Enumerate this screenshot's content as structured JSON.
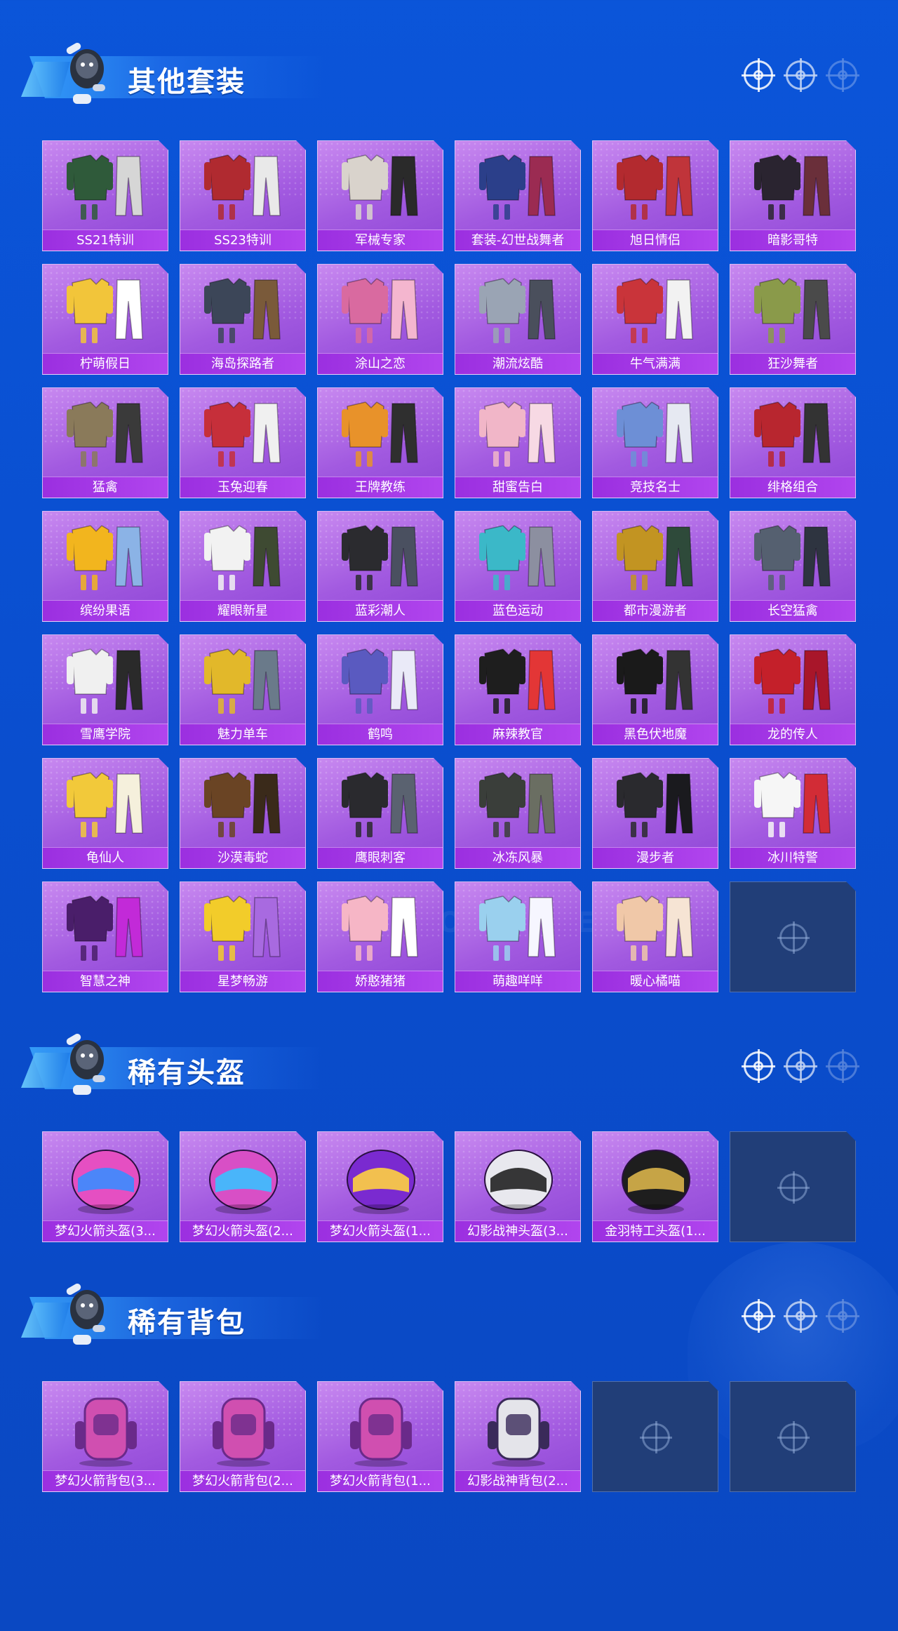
{
  "watermark": "GAME FOR PEACE",
  "sections": [
    {
      "title": "其他套装",
      "items": [
        {
          "label": "SS21特训",
          "icon": "outfit-green-icon"
        },
        {
          "label": "SS23特训",
          "icon": "outfit-red-jacket-icon"
        },
        {
          "label": "军械专家",
          "icon": "outfit-sweater-icon"
        },
        {
          "label": "套装-幻世战舞者",
          "icon": "outfit-blue-armor-icon"
        },
        {
          "label": "旭日情侣",
          "icon": "outfit-red-hoodie-icon"
        },
        {
          "label": "暗影哥特",
          "icon": "outfit-gothic-icon"
        },
        {
          "label": "柠萌假日",
          "icon": "outfit-yellow-dress-icon"
        },
        {
          "label": "海岛探路者",
          "icon": "outfit-explorer-icon"
        },
        {
          "label": "涂山之恋",
          "icon": "outfit-pink-robe-icon"
        },
        {
          "label": "潮流炫酷",
          "icon": "outfit-silver-jacket-icon"
        },
        {
          "label": "牛气满满",
          "icon": "outfit-red-festive-icon"
        },
        {
          "label": "狂沙舞者",
          "icon": "outfit-desert-scarf-icon"
        },
        {
          "label": "猛禽",
          "icon": "outfit-khaki-icon"
        },
        {
          "label": "玉兔迎春",
          "icon": "outfit-red-white-icon"
        },
        {
          "label": "王牌教练",
          "icon": "outfit-orange-vest-icon"
        },
        {
          "label": "甜蜜告白",
          "icon": "outfit-pink-icon"
        },
        {
          "label": "竞技名士",
          "icon": "outfit-blue-white-icon"
        },
        {
          "label": "绯格组合",
          "icon": "outfit-red-plaid-icon"
        },
        {
          "label": "缤纷果语",
          "icon": "outfit-fruit-icon"
        },
        {
          "label": "耀眼新星",
          "icon": "outfit-white-shirt-icon"
        },
        {
          "label": "蓝彩潮人",
          "icon": "outfit-black-jacket-icon"
        },
        {
          "label": "蓝色运动",
          "icon": "outfit-teal-sport-icon"
        },
        {
          "label": "都市漫游者",
          "icon": "outfit-yellow-hood-icon"
        },
        {
          "label": "长空猛禽",
          "icon": "outfit-camo-icon"
        },
        {
          "label": "雪鹰学院",
          "icon": "outfit-school-icon"
        },
        {
          "label": "魅力单车",
          "icon": "outfit-yellow-tee-icon"
        },
        {
          "label": "鹤鸣",
          "icon": "outfit-crane-hoodie-icon"
        },
        {
          "label": "麻辣教官",
          "icon": "outfit-striped-icon"
        },
        {
          "label": "黑色伏地魔",
          "icon": "outfit-black-hoodie-icon"
        },
        {
          "label": "龙的传人",
          "icon": "outfit-qipao-icon"
        },
        {
          "label": "龟仙人",
          "icon": "outfit-hawaiian-icon"
        },
        {
          "label": "沙漠毒蛇",
          "icon": "outfit-leather-icon"
        },
        {
          "label": "鹰眼刺客",
          "icon": "outfit-assassin-icon"
        },
        {
          "label": "冰冻风暴",
          "icon": "outfit-tactical-icon"
        },
        {
          "label": "漫步者",
          "icon": "outfit-walker-icon"
        },
        {
          "label": "冰川特警",
          "icon": "outfit-white-red-icon"
        },
        {
          "label": "智慧之神",
          "icon": "outfit-purple-god-icon"
        },
        {
          "label": "星梦畅游",
          "icon": "outfit-star-icon"
        },
        {
          "label": "娇憨猪猪",
          "icon": "outfit-pig-icon"
        },
        {
          "label": "萌趣咩咩",
          "icon": "outfit-sheep-icon"
        },
        {
          "label": "暖心橘喵",
          "icon": "outfit-cat-icon"
        }
      ],
      "empty_slots": 1
    },
    {
      "title": "稀有头盔",
      "items": [
        {
          "label": "梦幻火箭头盔(3...",
          "icon": "helmet-pink-icon"
        },
        {
          "label": "梦幻火箭头盔(2...",
          "icon": "helmet-pink-icon"
        },
        {
          "label": "梦幻火箭头盔(1...",
          "icon": "helmet-purple-icon"
        },
        {
          "label": "幻影战神头盔(3...",
          "icon": "helmet-white-icon"
        },
        {
          "label": "金羽特工头盔(1...",
          "icon": "helmet-black-gold-icon"
        }
      ],
      "empty_slots": 1
    },
    {
      "title": "稀有背包",
      "items": [
        {
          "label": "梦幻火箭背包(3...",
          "icon": "backpack-pink-icon"
        },
        {
          "label": "梦幻火箭背包(2...",
          "icon": "backpack-pink-icon"
        },
        {
          "label": "梦幻火箭背包(1...",
          "icon": "backpack-pink-icon"
        },
        {
          "label": "幻影战神背包(2...",
          "icon": "backpack-white-icon"
        }
      ],
      "empty_slots": 2
    }
  ],
  "colors": {
    "background": "#0a4fd0",
    "card_top": "#c889f0",
    "card_bottom": "#8e46d6",
    "label_bar": "#9b2fe0",
    "empty_slot": "#213e78"
  }
}
